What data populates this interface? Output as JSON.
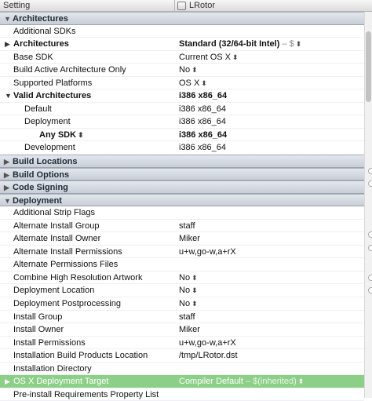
{
  "header": {
    "setting": "Setting",
    "target": "LRotor"
  },
  "rows": [
    {
      "type": "section",
      "open": true,
      "name": "Architectures"
    },
    {
      "type": "row",
      "level": 0,
      "name": "Additional SDKs",
      "value": ""
    },
    {
      "type": "row",
      "level": 0,
      "disclosure": "closed",
      "bold": true,
      "name": "Architectures",
      "value": "Standard (32/64-bit Intel)",
      "value_bold": true,
      "suffix": " –  $",
      "stepper": true
    },
    {
      "type": "row",
      "level": 0,
      "name": "Base SDK",
      "value": "Current OS X",
      "stepper": true
    },
    {
      "type": "row",
      "level": 0,
      "name": "Build Active Architecture Only",
      "value": "No",
      "stepper": true
    },
    {
      "type": "row",
      "level": 0,
      "name": "Supported Platforms",
      "value": "OS X",
      "stepper": true
    },
    {
      "type": "row",
      "level": 0,
      "disclosure": "open",
      "bold": true,
      "name": "Valid Architectures",
      "value": "i386 x86_64",
      "value_bold": true
    },
    {
      "type": "row",
      "level": 1,
      "name": "Default",
      "value": "i386 x86_64"
    },
    {
      "type": "row",
      "level": 1,
      "name": "Deployment",
      "value": "i386 x86_64"
    },
    {
      "type": "row",
      "level": 2,
      "bold": true,
      "name": "Any SDK",
      "name_stepper": true,
      "value": "i386 x86_64",
      "value_bold": true
    },
    {
      "type": "row",
      "level": 1,
      "name": "Development",
      "value": "i386 x86_64"
    },
    {
      "type": "section",
      "open": false,
      "name": "Build Locations"
    },
    {
      "type": "section",
      "open": false,
      "name": "Build Options"
    },
    {
      "type": "section",
      "open": false,
      "name": "Code Signing"
    },
    {
      "type": "section",
      "open": true,
      "name": "Deployment"
    },
    {
      "type": "row",
      "level": 0,
      "name": "Additional Strip Flags",
      "value": ""
    },
    {
      "type": "row",
      "level": 0,
      "name": "Alternate Install Group",
      "value": "staff"
    },
    {
      "type": "row",
      "level": 0,
      "name": "Alternate Install Owner",
      "value": "Miker"
    },
    {
      "type": "row",
      "level": 0,
      "name": "Alternate Install Permissions",
      "value": "u+w,go-w,a+rX"
    },
    {
      "type": "row",
      "level": 0,
      "name": "Alternate Permissions Files",
      "value": ""
    },
    {
      "type": "row",
      "level": 0,
      "name": "Combine High Resolution Artwork",
      "value": "No",
      "stepper": true
    },
    {
      "type": "row",
      "level": 0,
      "name": "Deployment Location",
      "value": "No",
      "stepper": true
    },
    {
      "type": "row",
      "level": 0,
      "name": "Deployment Postprocessing",
      "value": "No",
      "stepper": true
    },
    {
      "type": "row",
      "level": 0,
      "name": "Install Group",
      "value": "staff"
    },
    {
      "type": "row",
      "level": 0,
      "name": "Install Owner",
      "value": "Miker"
    },
    {
      "type": "row",
      "level": 0,
      "name": "Install Permissions",
      "value": "u+w,go-w,a+rX"
    },
    {
      "type": "row",
      "level": 0,
      "name": "Installation Build Products Location",
      "value": "/tmp/LRotor.dst"
    },
    {
      "type": "row",
      "level": 0,
      "name": "Installation Directory",
      "value": ""
    },
    {
      "type": "row",
      "level": 0,
      "disclosure": "closed",
      "selected": true,
      "name": "OS X Deployment Target",
      "value": "Compiler Default",
      "suffix": " – $(inherited)",
      "stepper": true
    },
    {
      "type": "row",
      "level": 0,
      "name": "Pre-install Requirements Property List",
      "value": ""
    }
  ]
}
